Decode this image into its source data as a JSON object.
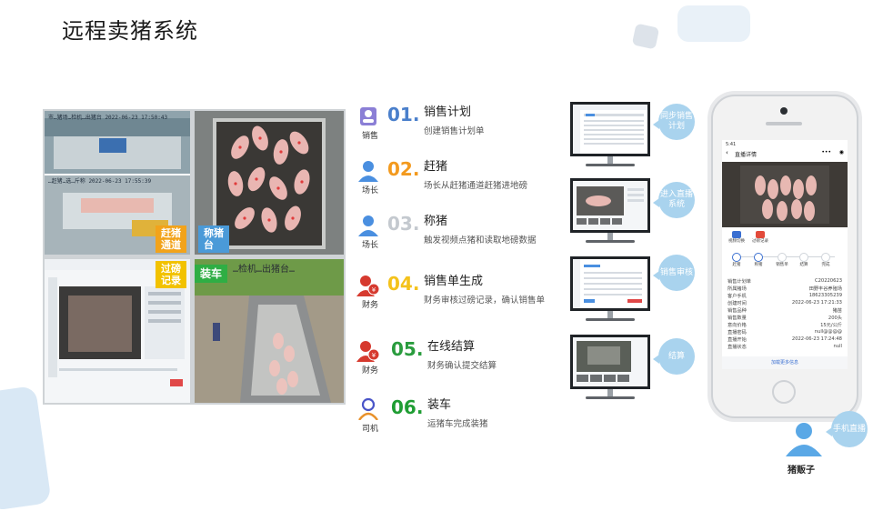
{
  "page": {
    "title": "远程卖猪系统"
  },
  "photos": {
    "tags": {
      "drive": "赶猪\n通道",
      "scale": "称猪\n台",
      "weigh": "过磅\n记录",
      "load": "装车"
    },
    "overlays": {
      "top": "市…猪场…检机…出猪台 2022-06-23 17:50:43",
      "mid": "…赶猪…选…斤称 2022-06-23 17:55:39",
      "load": "…检机…出猪台…"
    },
    "colors": {
      "drive": "#f2a31b",
      "scale": "#4a9ad8",
      "weigh": "#f2c200",
      "load": "#2fae44"
    }
  },
  "steps": [
    {
      "number": "01.",
      "name": "销售计划",
      "desc": "创建销售计划单",
      "role": "销售",
      "color": "#4a7fcb",
      "icon": "sales-person-icon"
    },
    {
      "number": "02.",
      "name": "赶猪",
      "desc": "场长从赶猪通道赶猪进地磅",
      "role": "场长",
      "color": "#f39a1e",
      "icon": "manager-icon"
    },
    {
      "number": "03.",
      "name": "称猪",
      "desc": "触发视频点猪和读取地磅数据",
      "role": "场长",
      "color": "#c4c9cf",
      "icon": "manager-icon"
    },
    {
      "number": "04.",
      "name": "销售单生成",
      "desc": "财务审核过磅记录，确认销售单",
      "role": "财务",
      "color": "#f4c21b",
      "icon": "finance-icon"
    },
    {
      "number": "05.",
      "name": "在线结算",
      "desc": "财务确认提交结算",
      "role": "财务",
      "color": "#2a9c3e",
      "icon": "finance-icon"
    },
    {
      "number": "06.",
      "name": "装车",
      "desc": "运猪车完成装猪",
      "role": "司机",
      "color": "#1f9d33",
      "icon": "driver-icon"
    }
  ],
  "bubbles": [
    "同步销售计划",
    "进入直播系统",
    "销售审核",
    "结算",
    "手机直播"
  ],
  "phone": {
    "status_time": "5:41",
    "header_title": "直播详情",
    "buttons": [
      "视频切换",
      "过磅记录"
    ],
    "progress_steps": [
      "赶猪",
      "称猪",
      "销售单",
      "结算",
      "完成"
    ],
    "details": [
      {
        "k": "销售计划单",
        "v": "C20220623"
      },
      {
        "k": "所属猪场",
        "v": "田野丰谷养殖场"
      },
      {
        "k": "客户手机",
        "v": "18623305239"
      },
      {
        "k": "创建时间",
        "v": "2022-06-23 17:21:33"
      },
      {
        "k": "销售品种",
        "v": "猪苗"
      },
      {
        "k": "销售数量",
        "v": "200头"
      },
      {
        "k": "意向价格",
        "v": "15元/公斤"
      },
      {
        "k": "直播密码",
        "v": "null@@@@"
      },
      {
        "k": "直播开始",
        "v": "2022-06-23 17:24:48"
      },
      {
        "k": "直播状态",
        "v": "null"
      }
    ],
    "footer_button": "加载更多信息"
  },
  "dealer": {
    "label": "猪贩子"
  }
}
